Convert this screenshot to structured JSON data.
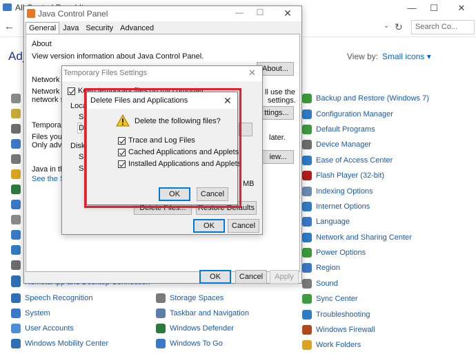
{
  "control_panel": {
    "title": "All Control Panel Items",
    "search_placeholder": "Search Co...",
    "heading": "Adj",
    "view_by_label": "View by:",
    "view_by_value": "Small icons ▾",
    "window_controls": [
      "—",
      "☐",
      "✕"
    ],
    "left_column": [
      {
        "label": "Speech Recognition",
        "icon": "microphone-icon",
        "color": "#2f6fb6"
      },
      {
        "label": "System",
        "icon": "computer-icon",
        "color": "#3a78c8"
      },
      {
        "label": "User Accounts",
        "icon": "users-icon",
        "color": "#4c8fd6"
      },
      {
        "label": "Windows Mobility Center",
        "icon": "mobility-icon",
        "color": "#2f6fb6"
      }
    ],
    "middle_column": [
      {
        "label": "Storage Spaces",
        "icon": "storage-icon",
        "color": "#7a7a7a"
      },
      {
        "label": "Taskbar and Navigation",
        "icon": "taskbar-icon",
        "color": "#5a7ea8"
      },
      {
        "label": "Windows Defender",
        "icon": "shield-icon",
        "color": "#2b7a3d"
      },
      {
        "label": "Windows To Go",
        "icon": "windows-to-go-icon",
        "color": "#3a78c8"
      }
    ],
    "right_column": [
      {
        "label": "Backup and Restore (Windows 7)",
        "icon": "backup-icon",
        "color": "#3c9b3c"
      },
      {
        "label": "Configuration Manager",
        "icon": "config-manager-icon",
        "color": "#2f7bc4"
      },
      {
        "label": "Default Programs",
        "icon": "default-programs-icon",
        "color": "#3c9b3c"
      },
      {
        "label": "Device Manager",
        "icon": "device-manager-icon",
        "color": "#6d6d6d"
      },
      {
        "label": "Ease of Access Center",
        "icon": "ease-of-access-icon",
        "color": "#2f7bc4"
      },
      {
        "label": "Flash Player (32-bit)",
        "icon": "flash-icon",
        "color": "#b01e1e"
      },
      {
        "label": "Indexing Options",
        "icon": "indexing-icon",
        "color": "#6a8bb0"
      },
      {
        "label": "Internet Options",
        "icon": "globe-icon",
        "color": "#2f7bc4"
      },
      {
        "label": "Language",
        "icon": "language-icon",
        "color": "#3a78c8"
      },
      {
        "label": "Network and Sharing Center",
        "icon": "network-icon",
        "color": "#2f7bc4"
      },
      {
        "label": "Power Options",
        "icon": "power-icon",
        "color": "#3c9b3c"
      },
      {
        "label": "Region",
        "icon": "region-icon",
        "color": "#3a78c8"
      },
      {
        "label": "Sound",
        "icon": "speaker-icon",
        "color": "#7a7a7a"
      },
      {
        "label": "Sync Center",
        "icon": "sync-icon",
        "color": "#3c9b3c"
      },
      {
        "label": "Troubleshooting",
        "icon": "troubleshoot-icon",
        "color": "#2f7bc4"
      },
      {
        "label": "Windows Firewall",
        "icon": "firewall-icon",
        "color": "#b04a1e"
      },
      {
        "label": "Work Folders",
        "icon": "folder-icon",
        "color": "#d9a520"
      }
    ],
    "partial_row_text": "RemoteApp and Desktop Connection"
  },
  "java_control_panel": {
    "title": "Java Control Panel",
    "tabs": [
      "General",
      "Java",
      "Security",
      "Advanced"
    ],
    "about_heading": "About",
    "about_text": "View version information about Java Control Panel.",
    "about_button": "About...",
    "network_heading": "Network Se",
    "network_line1": "Network se",
    "network_line2": "network se",
    "network_right1": "ll use the",
    "network_right2": "settings.",
    "settings_button": "ttings...",
    "temp_heading": "Temporary",
    "temp_line1": "Files you u",
    "temp_line2": "Only adva",
    "temp_right": "later.",
    "view_button": "iew...",
    "java_line1": "Java in the",
    "java_link": "See the Se",
    "ok": "OK",
    "cancel": "Cancel",
    "apply": "Apply"
  },
  "temp_files_settings": {
    "title": "Temporary Files Settings",
    "keep_checkbox": "Keep temporary files on my computer.",
    "location_label": "Locati",
    "select_label": "Se",
    "directory_label": "Di",
    "disk_label": "Disk S",
    "disk_line1": "Se",
    "disk_line2": "Se",
    "mb_label": "MB",
    "delete_button": "Delete Files...",
    "restore_button": "Restore Defaults",
    "ok": "OK",
    "cancel": "Cancel"
  },
  "delete_dialog": {
    "title": "Delete Files and Applications",
    "prompt": "Delete the following files?",
    "options": [
      {
        "label": "Trace and Log Files",
        "checked": true
      },
      {
        "label": "Cached Applications and Applets",
        "checked": true
      },
      {
        "label": "Installed Applications and Applets",
        "checked": true
      }
    ],
    "ok": "OK",
    "cancel": "Cancel"
  }
}
